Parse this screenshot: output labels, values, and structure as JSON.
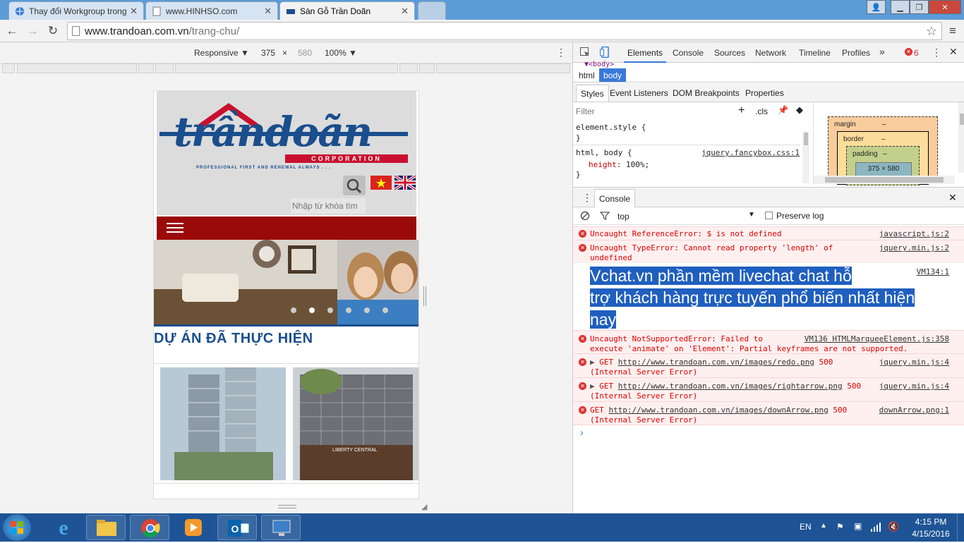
{
  "browser": {
    "tabs": [
      {
        "title": "Thay đổi Workgroup trong",
        "active": false
      },
      {
        "title": "www.HINHSO.com",
        "active": false
      },
      {
        "title": "Sàn Gỗ Trần Doãn",
        "active": true
      }
    ],
    "url_host": "www.trandoan.com.vn",
    "url_path": "/trang-chu/"
  },
  "device_toolbar": {
    "mode": "Responsive",
    "width": "375",
    "times": "×",
    "height": "580",
    "zoom": "100%"
  },
  "mobile_page": {
    "logo_text": "trầndoãn",
    "logo_corp": "CORPORATION",
    "logo_tagline": "PROFESSIONAL FIRST AND RENEWAL ALWAYS . . .",
    "search_placeholder": "Nhập từ khóa tìm",
    "section_title": "DỰ ÁN ĐÃ THỰC HIỆN",
    "project2_caption": "LIBERTY CENTRAL",
    "colors": {
      "nav_bar": "#9b0a0a",
      "logo_blue": "#1a4e8c",
      "logo_red": "#c8102e"
    }
  },
  "devtools": {
    "tabs": [
      "Elements",
      "Console",
      "Sources",
      "Network",
      "Timeline",
      "Profiles"
    ],
    "more": "»",
    "error_count": "6",
    "breadcrumb_top": "▼<body>",
    "crumbs": [
      "html",
      "body"
    ],
    "styles_tabs": [
      "Styles",
      "Event Listeners",
      "DOM Breakpoints",
      "Properties"
    ],
    "filter_placeholder": "Filter",
    "cls_label": ".cls",
    "add_rule": "+",
    "element_style_open": "element.style {",
    "element_style_close": "}",
    "rule_selector": "html, body {",
    "rule_source": "jquery.fancybox.css:1",
    "rule_prop": "height",
    "rule_value": "100%;",
    "rule_close": "}",
    "box_model": {
      "margin": "margin",
      "border": "border",
      "padding": "padding",
      "dash": "–",
      "size": "375 × 580"
    },
    "console_drawer_title": "Console",
    "console_context": "top",
    "preserve_log": "Preserve log",
    "messages": [
      {
        "text": "Uncaught ReferenceError: $ is not defined",
        "source": "javascript.js:2"
      },
      {
        "text": "Uncaught TypeError: Cannot read property 'length' of",
        "text2": "undefined",
        "source": "jquery.min.js:2"
      },
      {
        "text": "Uncaught NotSupportedError: Failed to",
        "text2": "execute 'animate' on 'Element': Partial keyframes are not supported.",
        "source": "VM136 HTMLMarqueeElement.js:358"
      },
      {
        "prefix": "GET",
        "url": "http://www.trandoan.com.vn/images/redo.png",
        "status": "500",
        "text2": "(Internal Server Error)",
        "source": "jquery.min.js:4"
      },
      {
        "prefix": "GET",
        "url": "http://www.trandoan.com.vn/images/rightarrow.png",
        "status": "500",
        "text2": "(Internal Server Error)",
        "source": "jquery.min.js:4"
      },
      {
        "prefix": "GET",
        "url": "http://www.trandoan.com.vn/images/downArrow.png",
        "status": "500",
        "text2": "(Internal Server Error)",
        "source": "downArrow.png:1"
      }
    ],
    "selected_log": {
      "source": "VM134:1",
      "line1": " Vchat.vn phần mềm livechat chat hỗ",
      "line2": "trợ khách hàng trực tuyến phổ biến nhất hiện",
      "line3": "nay"
    },
    "prompt": "›"
  },
  "taskbar": {
    "lang": "EN",
    "time": "4:15 PM",
    "date": "4/15/2016"
  }
}
